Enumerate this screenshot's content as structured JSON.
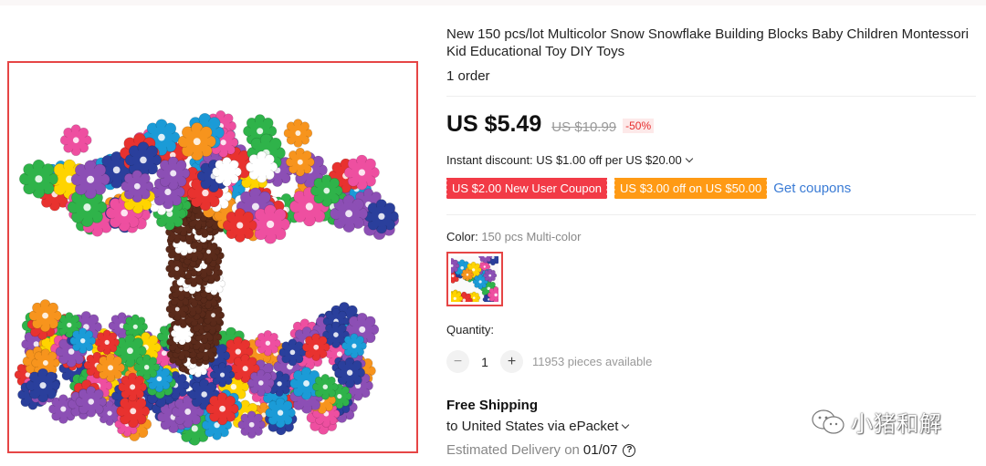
{
  "product": {
    "title": "New 150 pcs/lot Multicolor Snow Snowflake Building Blocks Baby Children Montessori Kid Educational Toy DIY Toys",
    "orders": "1 order"
  },
  "price": {
    "current": "US $5.49",
    "original": "US $10.99",
    "discount": "-50%"
  },
  "instant_discount": "Instant discount: US $1.00 off per US $20.00",
  "coupons": {
    "new_user": "US $2.00 New User Coupon",
    "threshold": "US $3.00 off on US $50.00",
    "get_label": "Get coupons"
  },
  "color": {
    "label": "Color:",
    "value": "150 pcs Multi-color"
  },
  "quantity": {
    "label": "Quantity:",
    "minus": "−",
    "plus": "+",
    "value": "1",
    "available": "11953 pieces available"
  },
  "shipping": {
    "title": "Free Shipping",
    "destination": "to United States via ePacket",
    "delivery_label": "Estimated Delivery on",
    "delivery_date": "01/07",
    "help": "?"
  },
  "watermark": "小猪和解",
  "colors": {
    "accent_red": "#e64545",
    "coupon_red": "#f23a46",
    "coupon_orange": "#ff9a14",
    "link_blue": "#3a7bd5"
  }
}
